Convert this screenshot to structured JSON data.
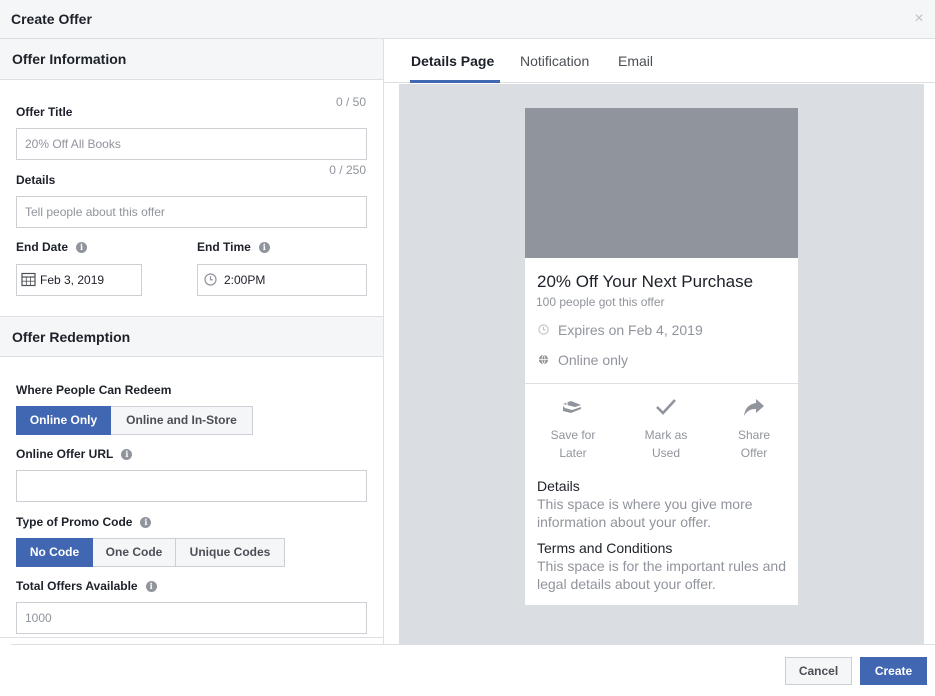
{
  "dialog": {
    "title": "Create Offer",
    "close_glyph": "×"
  },
  "offer_info": {
    "heading": "Offer Information",
    "title_label": "Offer Title",
    "title_counter": "0 / 50",
    "title_placeholder": "20% Off All Books",
    "details_label": "Details",
    "details_counter": "0 / 250",
    "details_placeholder": "Tell people about this offer",
    "end_date_label": "End Date",
    "end_date_value": "Feb 3, 2019",
    "end_time_label": "End Time",
    "end_time_value": "2:00PM"
  },
  "redemption": {
    "heading": "Offer Redemption",
    "where_label": "Where People Can Redeem",
    "where_options": [
      "Online Only",
      "Online and In-Store"
    ],
    "where_selected": "Online Only",
    "url_label": "Online Offer URL",
    "url_value": "",
    "promo_label": "Type of Promo Code",
    "promo_options": [
      "No Code",
      "One Code",
      "Unique Codes"
    ],
    "promo_selected": "No Code",
    "total_label": "Total Offers Available",
    "total_placeholder": "1000"
  },
  "tabs": [
    {
      "label": "Details Page",
      "active": true
    },
    {
      "label": "Notification",
      "active": false
    },
    {
      "label": "Email",
      "active": false
    }
  ],
  "preview": {
    "headline": "20% Off Your Next Purchase",
    "claimed": "100 people got this offer",
    "expires": "Expires on Feb 4, 2019",
    "availability": "Online only",
    "actions": [
      {
        "line1": "Save for",
        "line2": "Later",
        "icon": "save-for-later-icon"
      },
      {
        "line1": "Mark as",
        "line2": "Used",
        "icon": "checkmark-icon"
      },
      {
        "line1": "Share",
        "line2": "Offer",
        "icon": "share-arrow-icon"
      }
    ],
    "details_title": "Details",
    "details_body": "This space is where you give more information about your offer.",
    "terms_title": "Terms and Conditions",
    "terms_body": "This space is for the important rules and legal details about your offer."
  },
  "footer": {
    "cancel_label": "Cancel",
    "create_label": "Create"
  },
  "colors": {
    "accent": "#4267b2",
    "panel_bg": "#f5f6f7",
    "preview_bg": "#dadde1",
    "image_placeholder": "#90949c"
  }
}
